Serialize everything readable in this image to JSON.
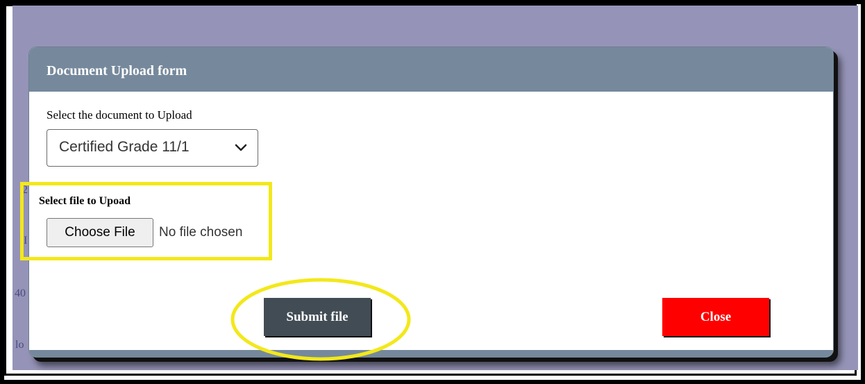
{
  "background_fragments": [
    "2",
    "I",
    "40",
    "lo"
  ],
  "modal": {
    "title": "Document Upload form",
    "document_select": {
      "label": "Select the document to Upload",
      "selected_value": "Certified Grade 11/1"
    },
    "file_input": {
      "label": "Select file to Upoad",
      "button_label": "Choose File",
      "status_text": "No file chosen"
    },
    "submit_label": "Submit file",
    "close_label": "Close"
  },
  "colors": {
    "backdrop": "#9594b8",
    "header": "#76899c",
    "submit": "#424c55",
    "close": "#ff0000",
    "highlight": "#f3e81a"
  },
  "icons": {
    "select_arrow": "chevron-down-icon"
  }
}
